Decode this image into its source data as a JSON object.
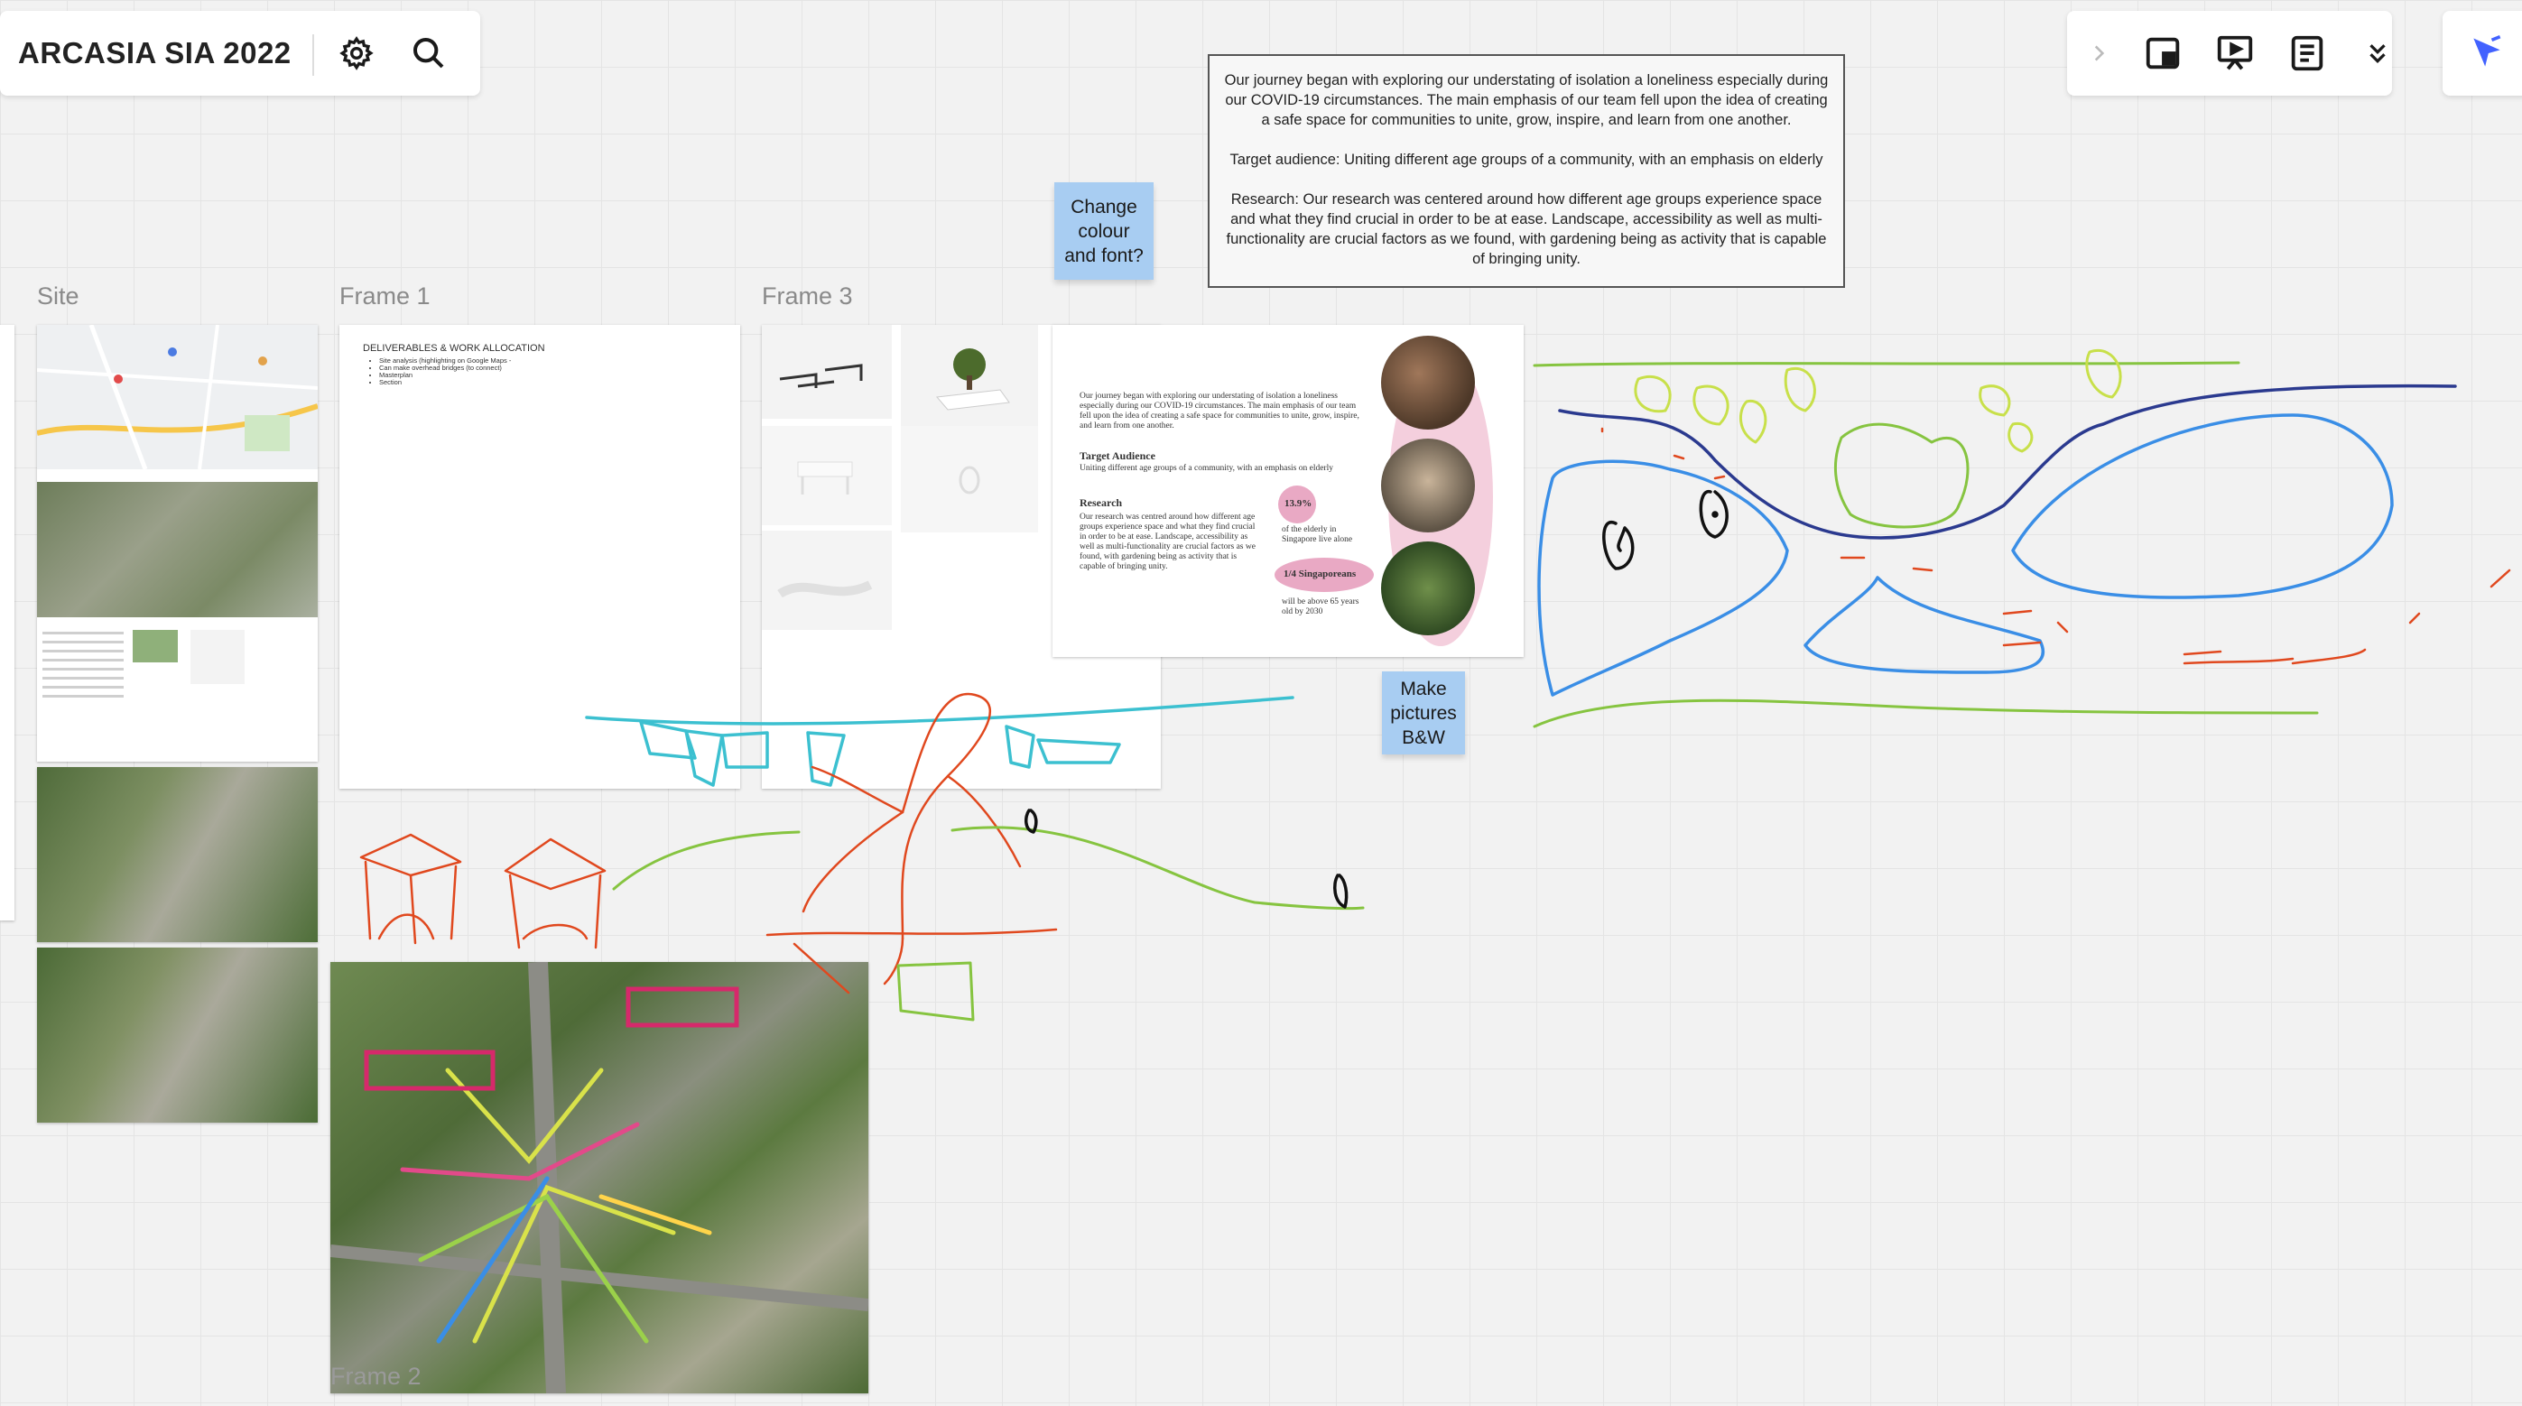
{
  "board": {
    "title": "ARCASIA SIA 2022",
    "settings_icon": "gear-icon",
    "search_icon": "search-icon"
  },
  "toolbar": {
    "icons": [
      "chevron-right-icon",
      "board-frame-icon",
      "presentation-icon",
      "notes-icon",
      "chevron-double-down-icon",
      "cursor-icon"
    ],
    "accent": "#4262ff"
  },
  "description": {
    "p1": "Our journey began with exploring our understating of isolation a loneliness especially during our COVID-19 circumstances. The main emphasis of our team fell upon the idea of creating a safe space for communities to unite, grow, inspire, and learn from one another.",
    "p2": "Target audience: Uniting different age groups of a community, with an emphasis on elderly",
    "p3": "Research: Our research was centered around how different age groups experience space and what they find crucial in order to be at ease. Landscape, accessibility as well as multi-functionality are crucial factors as we found, with gardening being as activity that is capable of bringing unity."
  },
  "frames": {
    "site": "Site",
    "frame1": "Frame 1",
    "frame3": "Frame 3",
    "frame2": "Frame 2"
  },
  "frame1_content": {
    "heading": "DELIVERABLES & WORK ALLOCATION",
    "bullets": [
      "Site analysis (highlighting on Google Maps -",
      "Can make overhead bridges (to connect)",
      "Masterplan",
      "Section"
    ]
  },
  "stickies": {
    "change": "Change\ncolour\nand font?",
    "make": "Make\npictures\nB&W"
  },
  "poster": {
    "intro": "Our journey began with exploring our understating of isolation a loneliness especially during our COVID-19 circumstances. The main emphasis of our team fell upon the idea of creating a safe space for communities to unite, grow, inspire, and learn from one another.",
    "target_heading": "Target Audience",
    "target_text": "Uniting different age groups of a community, with an emphasis on elderly",
    "research_heading": "Research",
    "research_text": "Our research was centred around how different age groups experience space and what they find crucial in order to be at ease. Landscape, accessibility as well as multi-functionality are crucial factors as we found, with gardening being as activity that is capable of bringing unity.",
    "stat1_value": "13.9%",
    "stat1_text": "of the elderly in Singapore live alone",
    "stat2_value": "1/4 Singaporeans",
    "stat2_text": "will be above 65 years old by 2030"
  },
  "colors": {
    "sticky": "#a8cdf2",
    "ink_blue": "#3a8ee6",
    "ink_navy": "#2b3a8f",
    "ink_green": "#86c440",
    "ink_lime": "#c8e04a",
    "ink_red": "#e0481e",
    "ink_cyan": "#3cc0d0"
  }
}
